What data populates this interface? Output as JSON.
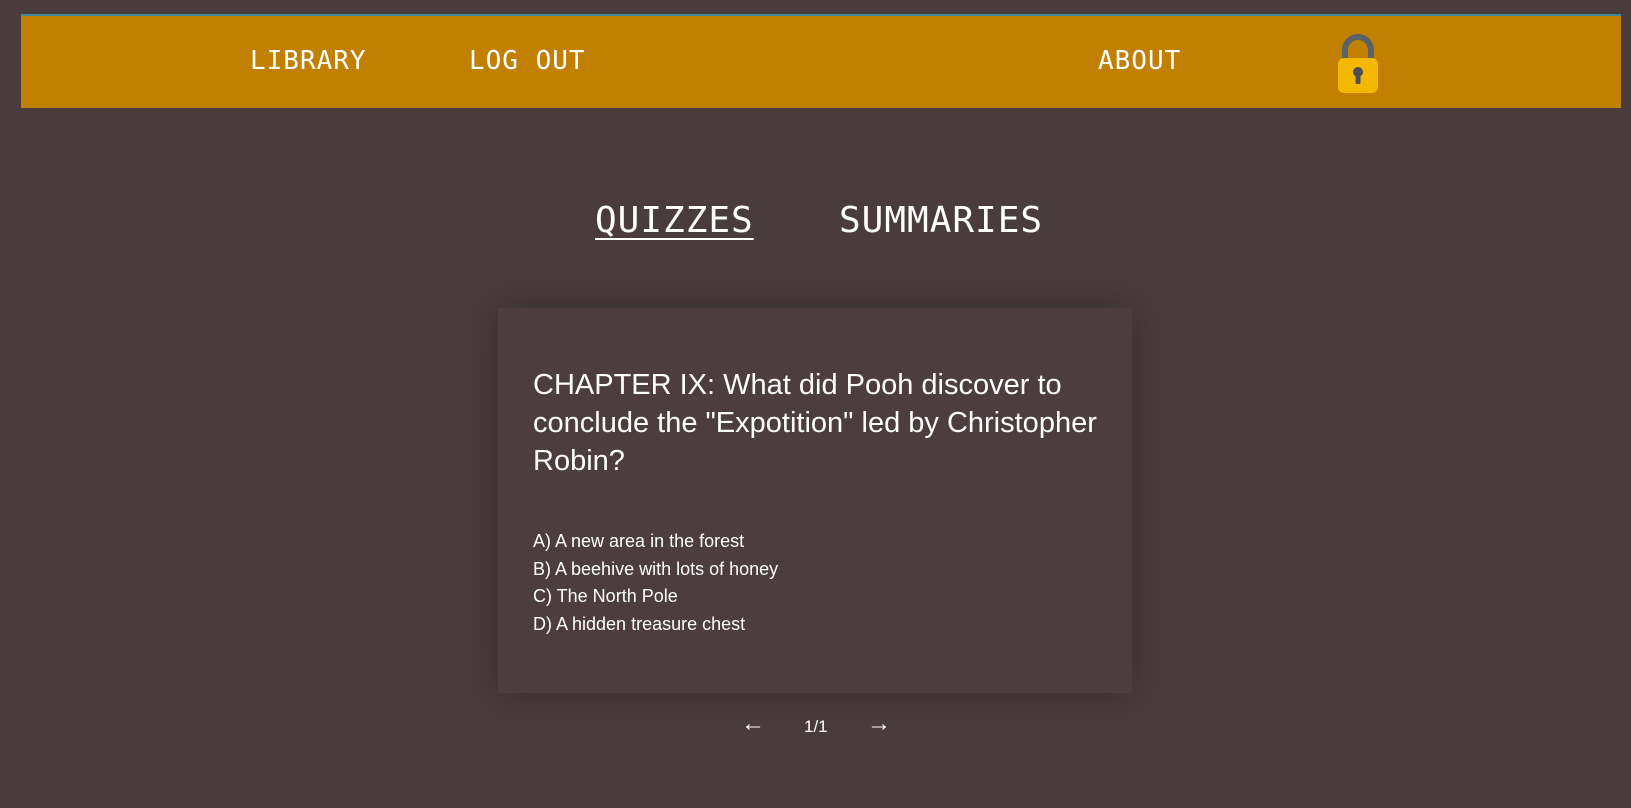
{
  "nav": {
    "library": "LIBRARY",
    "logout": "LOG OUT",
    "about": "ABOUT",
    "lock_icon": "lock-icon"
  },
  "tabs": {
    "quizzes": "QUIZZES",
    "summaries": "SUMMARIES",
    "active": "quizzes"
  },
  "quiz": {
    "question": "CHAPTER IX: What did Pooh discover to conclude the \"Expotition\" led by Christopher Robin?",
    "options": [
      "A) A new area in the forest",
      "B) A beehive with lots of honey",
      "C) The North Pole",
      "D) A hidden treasure chest"
    ]
  },
  "pagination": {
    "prev_icon": "arrow-left-icon",
    "prev": "←",
    "indicator": "1/1",
    "next_icon": "arrow-right-icon",
    "next": "→"
  },
  "colors": {
    "background": "#4a3c3d",
    "navbar": "#c18000",
    "card": "#4d3d3e",
    "lock_body": "#f5b800",
    "lock_shackle": "#5a6168"
  }
}
